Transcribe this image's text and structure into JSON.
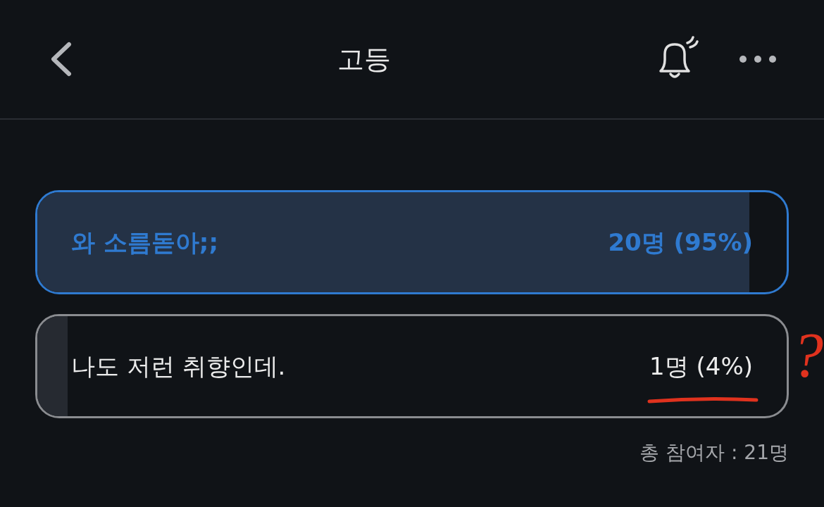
{
  "header": {
    "title": "고등"
  },
  "poll": {
    "options": [
      {
        "label": "와 소름돋아;;",
        "result": "20명 (95%)",
        "selected": true,
        "level": 0.95
      },
      {
        "label": "나도 저런 취향인데.",
        "result": "1명 (4%)",
        "selected": false,
        "level": 0.04
      }
    ],
    "total": "총 참여자 : 21명"
  },
  "annotation": {
    "underline": true,
    "mark": "?"
  }
}
